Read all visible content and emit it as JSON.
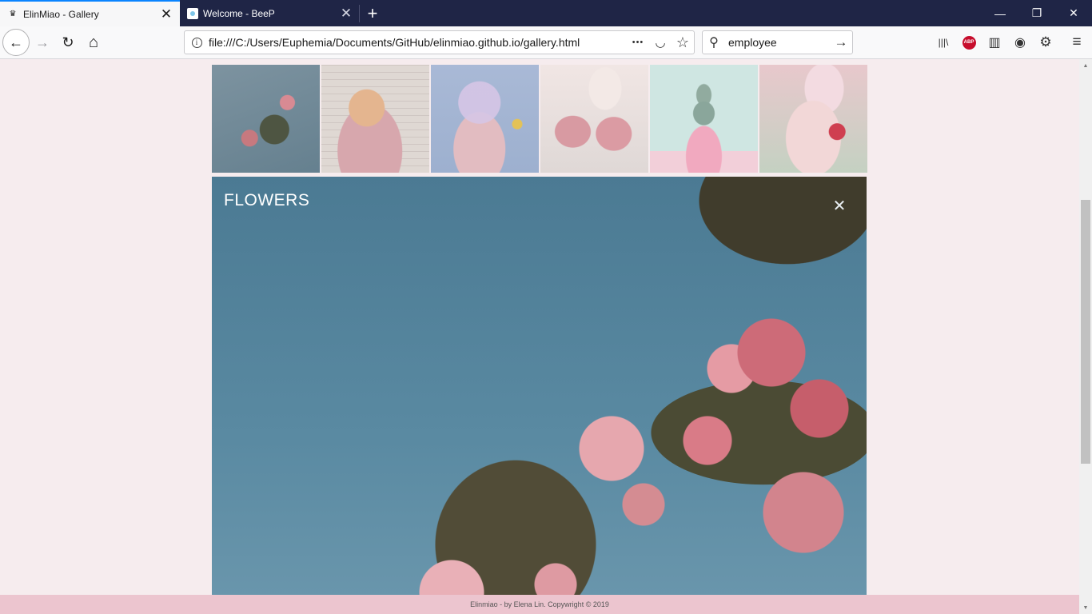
{
  "browser": {
    "tabs": [
      {
        "title": "ElinMiao - Gallery",
        "favicon": "crown-icon",
        "active": true
      },
      {
        "title": "Welcome - BeeP",
        "favicon": "beep-favicon",
        "active": false
      }
    ],
    "new_tab_symbol": "+",
    "tab_close_symbol": "✕",
    "window_controls": {
      "minimize": "—",
      "restore": "❐",
      "close": "✕"
    },
    "url": "file:///C:/Users/Euphemia/Documents/GitHub/elinmiao.github.io/gallery.html",
    "search_value": "employee",
    "accent_color": "#0a84ff",
    "tabbar_color": "#1f2546",
    "icons": {
      "back": "←",
      "forward": "→",
      "reload": "↻",
      "home": "⌂",
      "info": "i",
      "page_actions": "•••",
      "pocket": "◡",
      "bookmark": "☆",
      "search": "⚲",
      "go": "→",
      "library": "|||\\",
      "abp": "ABP",
      "sidebar": "▥",
      "account": "◉",
      "settings": "⚙",
      "menu": "≡"
    }
  },
  "gallery": {
    "thumbnails": [
      {
        "subject": "pink flowers against blue sky"
      },
      {
        "subject": "girl with pink sweater and mug"
      },
      {
        "subject": "bubble and flowers"
      },
      {
        "subject": "ripple drink jars"
      },
      {
        "subject": "cactus in pink pot"
      },
      {
        "subject": "strawberry cake and bottles"
      }
    ],
    "viewer": {
      "title": "FLOWERS",
      "close_symbol": "✕"
    }
  },
  "footer": {
    "text": "Elinmiao - by Elena Lin. Copywright © 2019"
  },
  "colors": {
    "page_background": "#f6ecee",
    "footer_background": "#ecc5cf"
  }
}
